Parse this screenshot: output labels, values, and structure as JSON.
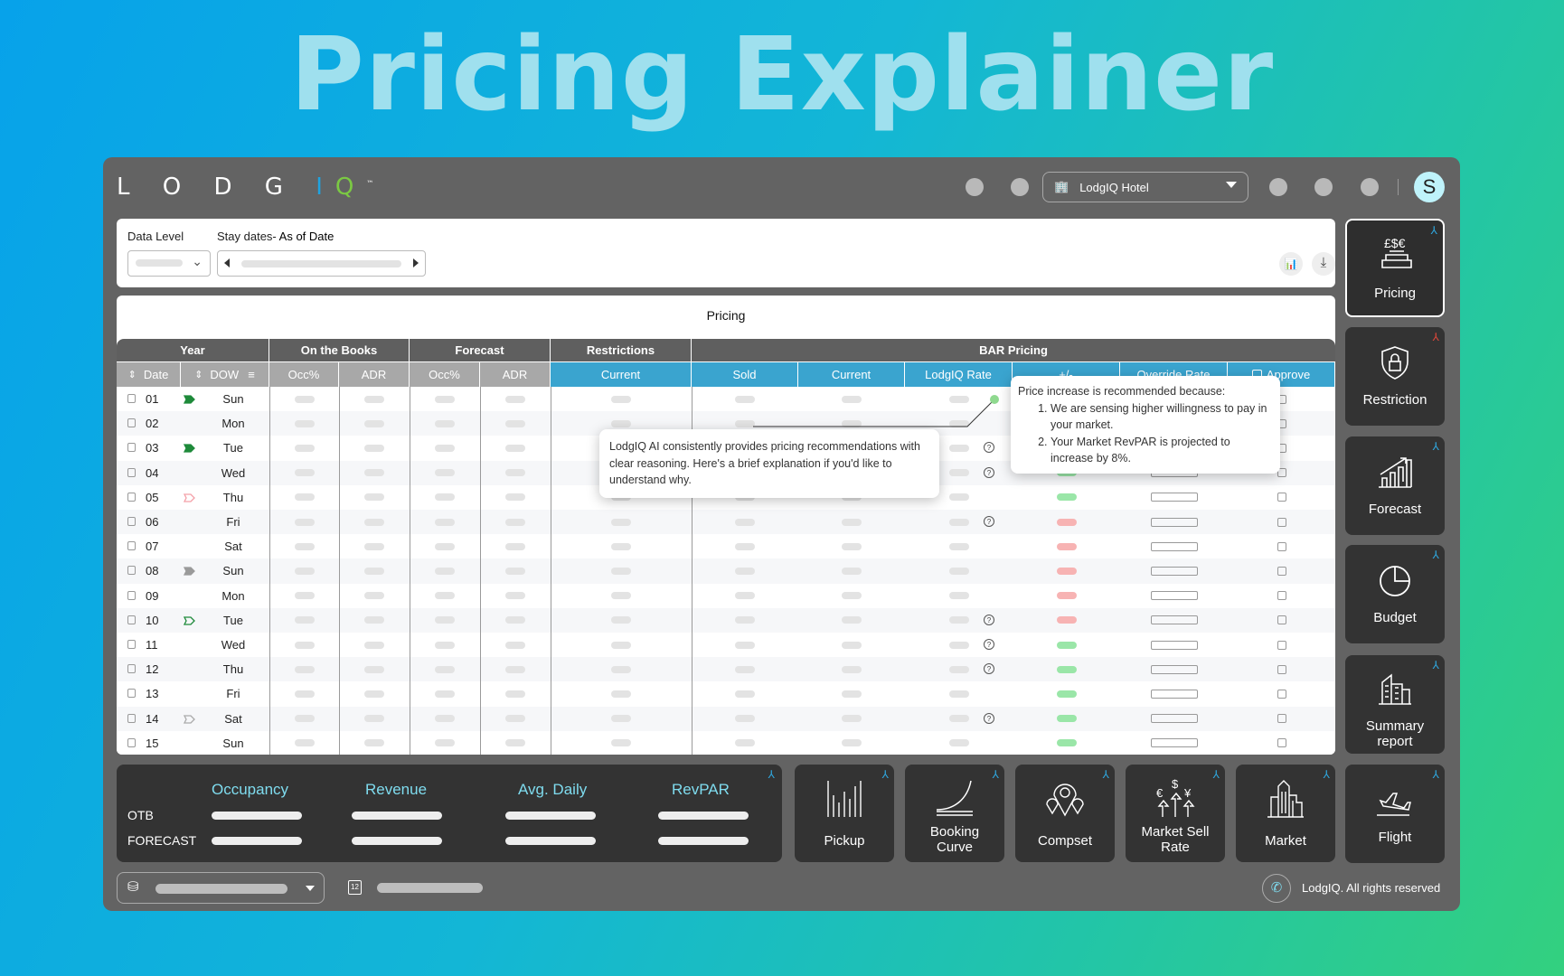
{
  "page_title": "Pricing Explainer",
  "header": {
    "logo": "LODGIQ",
    "logo_tm": "™",
    "hotel": "LodgIQ Hotel",
    "avatar": "S"
  },
  "filters": {
    "data_level_label": "Data Level",
    "stay_dates_label": "Stay dates-",
    "as_of_label": "As of Date"
  },
  "table": {
    "title": "Pricing",
    "groups": [
      "Year",
      "On the Books",
      "Forecast",
      "Restrictions",
      "BAR Pricing"
    ],
    "columns": [
      "Date",
      "DOW",
      "Occ%",
      "ADR",
      "Occ%",
      "ADR",
      "Current",
      "Sold",
      "Current",
      "LodgIQ Rate",
      "+/-",
      "Override Rate",
      "Approve"
    ],
    "rows": [
      {
        "date": "01",
        "dow": "Sun",
        "flag": "green-filled",
        "rec": "dot",
        "delta": null
      },
      {
        "date": "02",
        "dow": "Mon",
        "flag": null,
        "rec": null,
        "delta": null
      },
      {
        "date": "03",
        "dow": "Tue",
        "flag": "green-filled",
        "rec": "question",
        "delta": null
      },
      {
        "date": "04",
        "dow": "Wed",
        "flag": null,
        "rec": "question",
        "delta": "green"
      },
      {
        "date": "05",
        "dow": "Thu",
        "flag": "pink-outline",
        "rec": null,
        "delta": "green"
      },
      {
        "date": "06",
        "dow": "Fri",
        "flag": null,
        "rec": "question",
        "delta": "red"
      },
      {
        "date": "07",
        "dow": "Sat",
        "flag": null,
        "rec": null,
        "delta": "red"
      },
      {
        "date": "08",
        "dow": "Sun",
        "flag": "gray-filled",
        "rec": null,
        "delta": "red"
      },
      {
        "date": "09",
        "dow": "Mon",
        "flag": null,
        "rec": null,
        "delta": "red"
      },
      {
        "date": "10",
        "dow": "Tue",
        "flag": "green-outline",
        "rec": "question",
        "delta": "red"
      },
      {
        "date": "11",
        "dow": "Wed",
        "flag": null,
        "rec": "question",
        "delta": "green"
      },
      {
        "date": "12",
        "dow": "Thu",
        "flag": null,
        "rec": "question",
        "delta": "green"
      },
      {
        "date": "13",
        "dow": "Fri",
        "flag": null,
        "rec": null,
        "delta": "green"
      },
      {
        "date": "14",
        "dow": "Sat",
        "flag": "gray-outline",
        "rec": "question",
        "delta": "green"
      },
      {
        "date": "15",
        "dow": "Sun",
        "flag": null,
        "rec": null,
        "delta": "green"
      }
    ]
  },
  "tooltips": {
    "intro": "LodgIQ AI consistently provides pricing recommendations with clear reasoning. Here's a brief explanation if you'd like to understand why.",
    "reason_title": "Price increase is recommended because:",
    "reasons": [
      "We are sensing higher willingness to pay in your market.",
      "Your Market RevPAR is projected to increase by 8%."
    ]
  },
  "sidebar": [
    {
      "label": "Pricing",
      "icon": "pricing-icon",
      "active": true,
      "pin": "blue"
    },
    {
      "label": "Restriction",
      "icon": "lock-shield-icon",
      "pin": "red"
    },
    {
      "label": "Forecast",
      "icon": "forecast-chart-icon",
      "pin": "blue"
    },
    {
      "label": "Budget",
      "icon": "pie-chart-icon",
      "pin": "blue"
    },
    {
      "label": "Summary report",
      "icon": "buildings-icon",
      "pin": "blue"
    },
    {
      "label": "Flight",
      "icon": "airplane-icon",
      "pin": "blue"
    }
  ],
  "kpi": {
    "headers": [
      "Occupancy",
      "Revenue",
      "Avg. Daily",
      "RevPAR"
    ],
    "rows": [
      "OTB",
      "FORECAST"
    ]
  },
  "bottom_cards": [
    {
      "label": "Pickup",
      "icon": "bar-lines-icon"
    },
    {
      "label": "Booking Curve",
      "icon": "curve-icon"
    },
    {
      "label": "Compset",
      "icon": "map-pins-icon"
    },
    {
      "label": "Market Sell Rate",
      "icon": "currency-arrows-icon"
    },
    {
      "label": "Market",
      "icon": "city-icon"
    }
  ],
  "footer": {
    "copyright": "LodgIQ. All rights reserved",
    "calendar_day": "12"
  },
  "colors": {
    "accent": "#3aa4cf",
    "positive": "#9ae6a8",
    "negative": "#f7b3b3",
    "flag_green": "#1e8a3a",
    "title": "#9fe0ee"
  }
}
